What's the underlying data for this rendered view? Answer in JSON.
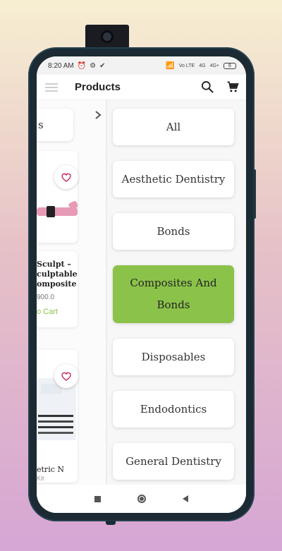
{
  "status_bar": {
    "time": "8:20 AM",
    "network_badges": [
      "Vo LTE",
      "4G",
      "4G+"
    ],
    "battery": "6"
  },
  "app_bar": {
    "title": "Products"
  },
  "left_panel": {
    "chip_text": "s",
    "product_1": {
      "name_lines": [
        "Sculpt –",
        "culptable",
        "omposite"
      ],
      "price": "900.0",
      "add_to_cart": "o Cart"
    },
    "product_2": {
      "name": "etric N",
      "sub": "Kit"
    }
  },
  "categories": [
    {
      "label": "All",
      "active": false
    },
    {
      "label": "Aesthetic Dentistry",
      "active": false
    },
    {
      "label": "Bonds",
      "active": false
    },
    {
      "label": "Composites And Bonds",
      "active": true
    },
    {
      "label": "Disposables",
      "active": false
    },
    {
      "label": "Endodontics",
      "active": false
    },
    {
      "label": "General Dentistry",
      "active": false
    }
  ],
  "colors": {
    "accent": "#8bc34a",
    "background_top": "#f7efd2",
    "background_bottom": "#d6a6d4"
  }
}
